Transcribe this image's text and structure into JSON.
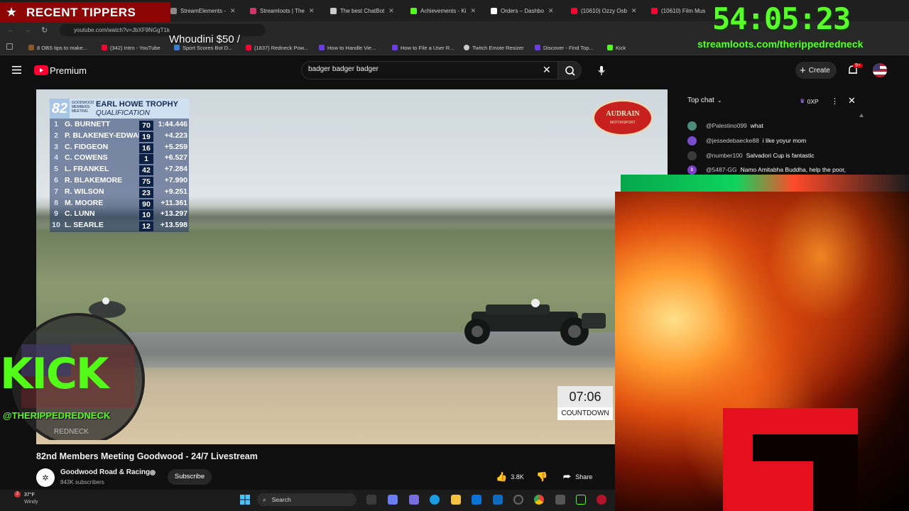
{
  "overlay": {
    "recent_tippers": "RECENT TIPPERS",
    "tipper_marquee": "Whoudini $50 /",
    "timer": "54:05:23",
    "streamloots_url": "streamloots.com/therippedredneck",
    "kick_text": "KICK",
    "kick_handle": "@THERIPPEDREDNECK",
    "kick_sub": "REDNECK"
  },
  "browser": {
    "tabs": [
      {
        "label": "StreamElements -",
        "color": "#8a8a8a"
      },
      {
        "label": "Streamloots | The",
        "color": "#d6336c"
      },
      {
        "label": "The best ChatBot",
        "color": "#cccccc"
      },
      {
        "label": "Achievements - Ki",
        "color": "#53fc18"
      },
      {
        "label": "Orders – Dashbo",
        "color": "#ffffff"
      },
      {
        "label": "(10610) Ozzy Osb",
        "color": "#ff0033"
      },
      {
        "label": "(10610) Film Mus",
        "color": "#ff0033"
      }
    ],
    "url": "youtube.com/watch?v=JbXF9NGgT1k",
    "bookmarks": [
      {
        "label": "8 OBS tips to make...",
        "color": "#8a5a2b"
      },
      {
        "label": "(342) Intro - YouTube",
        "color": "#ff0033"
      },
      {
        "label": "Sport Scores Bot D...",
        "color": "#3a7bd5"
      },
      {
        "label": "(1837) Redneck Pow...",
        "color": "#ff0033"
      },
      {
        "label": "How to Handle Vie...",
        "color": "#6a3de8"
      },
      {
        "label": "How to File a User R...",
        "color": "#6a3de8"
      },
      {
        "label": "Twitch Emote Resizer",
        "color": "#cccccc"
      },
      {
        "label": "Discover - Find Top...",
        "color": "#6a3de8"
      },
      {
        "label": "Kick",
        "color": "#53fc18"
      }
    ]
  },
  "youtube": {
    "logo_label": "Premium",
    "search_query": "badger badger badger",
    "create_label": "Create",
    "notif_badge": "9+",
    "video_title": "82nd Members Meeting Goodwood - 24/7 Livestream",
    "channel_name": "Goodwood Road & Racing",
    "subscribers": "843K subscribers",
    "subscribe_label": "Subscribe",
    "likes": "3.8K",
    "share_label": "Share"
  },
  "leaderboard": {
    "event_number": "82",
    "title": "EARL HOWE TROPHY",
    "subtitle": "QUALIFICATION",
    "rows": [
      {
        "pos": "1",
        "name": "G. BURNETT",
        "num": "70",
        "time": "1:44.446"
      },
      {
        "pos": "2",
        "name": "P. BLAKENEY-EDWARDS",
        "num": "19",
        "time": "+4.223"
      },
      {
        "pos": "3",
        "name": "C. FIDGEON",
        "num": "16",
        "time": "+5.259"
      },
      {
        "pos": "4",
        "name": "C. COWENS",
        "num": "1",
        "time": "+6.527"
      },
      {
        "pos": "5",
        "name": "L. FRANKEL",
        "num": "42",
        "time": "+7.284"
      },
      {
        "pos": "6",
        "name": "R. BLAKEMORE",
        "num": "75",
        "time": "+7.990"
      },
      {
        "pos": "7",
        "name": "R. WILSON",
        "num": "23",
        "time": "+9.251"
      },
      {
        "pos": "8",
        "name": "M. MOORE",
        "num": "90",
        "time": "+11.361"
      },
      {
        "pos": "9",
        "name": "C. LUNN",
        "num": "10",
        "time": "+13.297"
      },
      {
        "pos": "10",
        "name": "L. SEARLE",
        "num": "12",
        "time": "+13.598"
      }
    ],
    "sponsor_line1": "AUDRAIN",
    "sponsor_line2": "MOTORSPORT",
    "countdown_time": "07:06",
    "countdown_label": "COUNTDOWN"
  },
  "chat": {
    "header": "Top chat",
    "points": "0XP",
    "messages": [
      {
        "user": "@Palestino099",
        "text": "what",
        "color": "#4c8c7a"
      },
      {
        "user": "@jessedebaecke88",
        "text": "i like yoyur mom",
        "color": "#7a4ccc"
      },
      {
        "user": "@number100",
        "text": "Salvadori Cup is fantastic",
        "color": "#3a3a3a"
      },
      {
        "user": "@5487-GG",
        "text": "Namo Amitabha Buddha, help the poor,",
        "color": "#7a3fc2",
        "initial": "b"
      }
    ]
  },
  "taskbar": {
    "weather_temp": "37°F",
    "weather_desc": "Windy",
    "weather_badge": "2",
    "search_label": "Search"
  }
}
